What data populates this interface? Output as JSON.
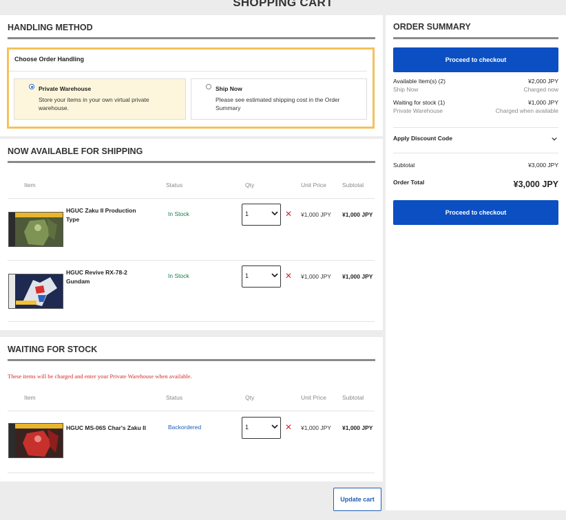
{
  "page": {
    "title": "SHOPPING CART"
  },
  "handling": {
    "heading": "HANDLING METHOD",
    "choose_label": "Choose Order Handling",
    "options": [
      {
        "title": "Private Warehouse",
        "desc": "Store your items in your own virtual private warehouse.",
        "selected": true
      },
      {
        "title": "Ship Now",
        "desc": "Please see estimated shipping cost in the Order Summary",
        "selected": false
      }
    ]
  },
  "columns": {
    "item": "Item",
    "status": "Status",
    "qty": "Qty",
    "unit_price": "Unit Price",
    "subtotal": "Subtotal"
  },
  "shipping": {
    "heading": "NOW AVAILABLE FOR SHIPPING",
    "items": [
      {
        "name": "HGUC Zaku II Production Type",
        "status": "In Stock",
        "qty": "1",
        "unit_price": "¥1,000 JPY",
        "subtotal": "¥1,000 JPY",
        "thumb": "zaku-green-box"
      },
      {
        "name": "HGUC Revive RX-78-2 Gundam",
        "status": "In Stock",
        "qty": "1",
        "unit_price": "¥1,000 JPY",
        "subtotal": "¥1,000 JPY",
        "thumb": "gundam-box"
      }
    ]
  },
  "waiting": {
    "heading": "WAITING FOR STOCK",
    "notice": "These items will be charged and enter your Private Warehouse when available.",
    "items": [
      {
        "name": "HGUC MS-06S Char's Zaku II",
        "status": "Backordered",
        "qty": "1",
        "unit_price": "¥1,000 JPY",
        "subtotal": "¥1,000 JPY",
        "thumb": "char-zaku-box"
      }
    ]
  },
  "update_cart": "Update cart",
  "summary": {
    "heading": "ORDER SUMMARY",
    "checkout_label": "Proceed to checkout",
    "available_label": "Available Item(s) (2)",
    "available_value": "¥2,000 JPY",
    "ship_now": "Ship Now",
    "charged_now": "Charged now",
    "waiting_label": "Waiting for stock (1)",
    "waiting_value": "¥1,000 JPY",
    "private_warehouse": "Private Warehouse",
    "charged_available": "Charged when available",
    "discount_label": "Apply Discount Code",
    "subtotal_label": "Subtotal",
    "subtotal_value": "¥3,000 JPY",
    "total_label": "Order Total",
    "total_value": "¥3,000 JPY"
  },
  "colors": {
    "accent": "#0b4fc2",
    "highlight_border": "#f6c15a",
    "in_stock": "#167a4a",
    "error": "#d32b2b"
  }
}
